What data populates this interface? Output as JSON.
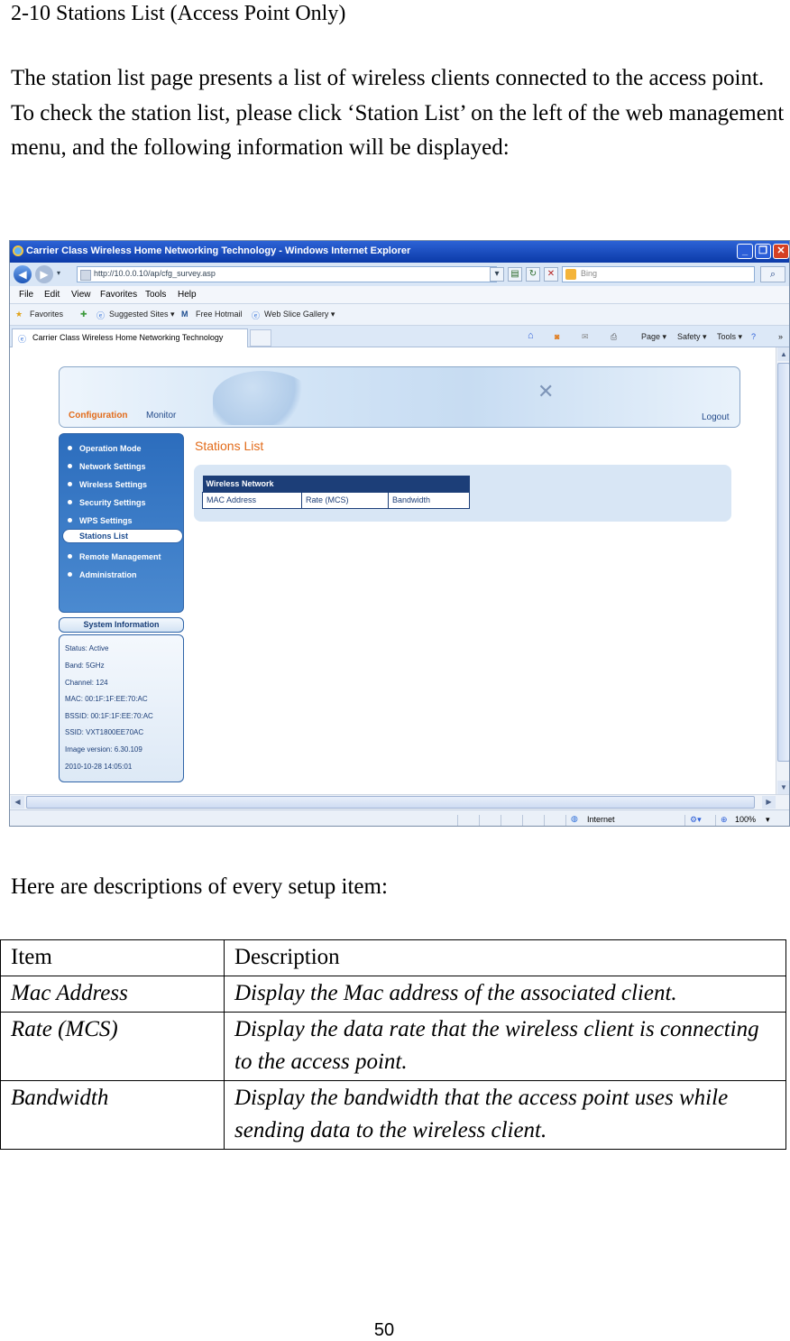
{
  "heading": "2-10 Stations List (Access Point Only)",
  "intro": "The station list page presents a list of wireless clients connected to the access point. To check the station list, please click ‘Station List’ on the left of the web management menu, and the following information will be displayed:",
  "screenshot": {
    "window_title": "Carrier Class Wireless Home Networking Technology - Windows Internet Explorer",
    "window_buttons": [
      "_",
      "❐",
      "✕"
    ],
    "address_url": "http://10.0.0.10/ap/cfg_survey.asp",
    "search_placeholder": "Bing",
    "menu": [
      "File",
      "Edit",
      "View",
      "Favorites",
      "Tools",
      "Help"
    ],
    "favorites": {
      "favorites_label": "Favorites",
      "links": [
        "Suggested Sites ▾",
        "Free Hotmail",
        "Web Slice Gallery ▾"
      ]
    },
    "tab_title": "Carrier Class Wireless Home Networking Technology",
    "commands": [
      "Page ▾",
      "Safety ▾",
      "Tools ▾"
    ],
    "page": {
      "tab_configuration": "Configuration",
      "tab_monitor": "Monitor",
      "logout": "Logout",
      "menu_items": [
        "Operation Mode",
        "Network Settings",
        "Wireless Settings",
        "Security Settings",
        "WPS Settings",
        "Stations List",
        "Remote Management",
        "Administration"
      ],
      "active_item": "Stations List",
      "system_info_title": "System Information",
      "system_info": [
        "Status: Active",
        "Band: 5GHz",
        "Channel: 124",
        "MAC: 00:1F:1F:EE:70:AC",
        "BSSID: 00:1F:1F:EE:70:AC",
        "SSID: VXT1800EE70AC",
        "Image version: 6.30.109",
        "2010-10-28 14:05:01"
      ],
      "stations_title": "Stations List",
      "table_title": "Wireless Network",
      "table_columns": [
        "MAC Address",
        "Rate (MCS)",
        "Bandwidth"
      ]
    },
    "status": {
      "zone": "Internet",
      "zoom": "100%"
    }
  },
  "desc_intro": "Here are descriptions of every setup item:",
  "desc_table": {
    "headers": [
      "Item",
      "Description"
    ],
    "rows": [
      {
        "item": "Mac Address",
        "description": "Display the Mac address of the associated client."
      },
      {
        "item": "Rate (MCS)",
        "description": "Display the data rate that the wireless client is connecting to the access point."
      },
      {
        "item": "Bandwidth",
        "description": "Display the bandwidth that the access point uses while sending data to the wireless client."
      }
    ]
  },
  "page_number": "50"
}
